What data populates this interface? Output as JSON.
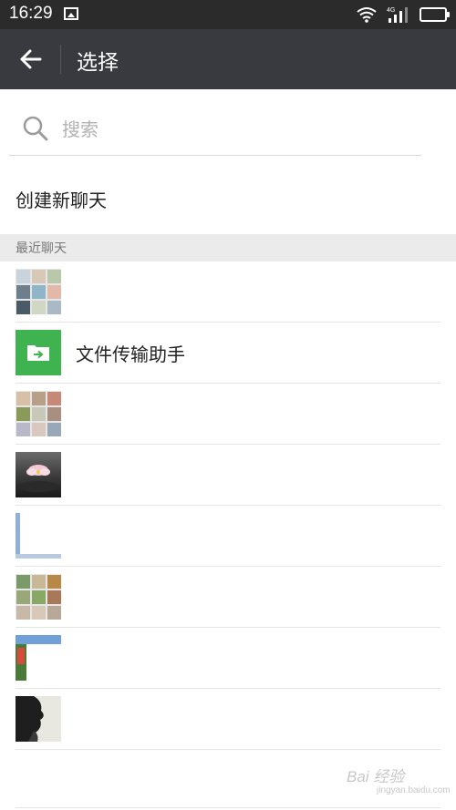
{
  "status_bar": {
    "time": "16:29",
    "network": "4G"
  },
  "app_bar": {
    "title": "选择"
  },
  "search": {
    "placeholder": "搜索",
    "value": ""
  },
  "create_chat": {
    "label": "创建新聊天"
  },
  "recent": {
    "header": "最近聊天",
    "items": [
      {
        "type": "group-avatar",
        "name": ""
      },
      {
        "type": "file-transfer",
        "name": "文件传输助手"
      },
      {
        "type": "group-avatar",
        "name": ""
      },
      {
        "type": "photo-avatar",
        "name": ""
      },
      {
        "type": "photo-avatar",
        "name": ""
      },
      {
        "type": "group-avatar",
        "name": ""
      },
      {
        "type": "photo-avatar",
        "name": ""
      },
      {
        "type": "photo-avatar",
        "name": ""
      }
    ]
  },
  "colors": {
    "status_bar": "#2b2b2b",
    "app_bar": "#393a3f",
    "file_transfer": "#3fb34f",
    "section_header_bg": "#ebebeb"
  },
  "icons": [
    "back-arrow-icon",
    "search-icon",
    "folder-icon",
    "wifi-icon",
    "signal-icon",
    "battery-icon"
  ],
  "watermark": {
    "text": "Bai 经验",
    "sub": "jingyan.baidu.com"
  }
}
